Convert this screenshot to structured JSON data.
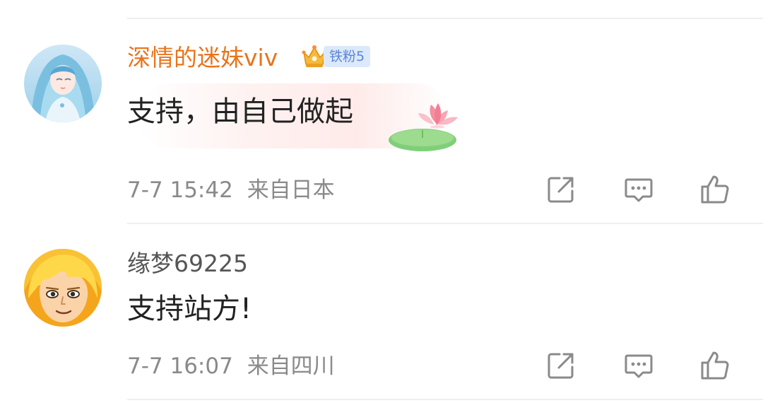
{
  "comments": [
    {
      "username": "深情的迷妹viv",
      "fan_badge": "铁粉5",
      "text": "支持，由自己做起",
      "time": "7-7 15:42",
      "location": "来自日本"
    },
    {
      "username": "缘梦69225",
      "text": "支持站方!",
      "time": "7-7 16:07",
      "location": "来自四川"
    }
  ],
  "colors": {
    "vip_name": "#e8741b",
    "normal_name": "#555555",
    "body_text": "#222222",
    "meta_text": "#8a8a8a",
    "icon": "#8a8a8a",
    "fan_badge_bg": "#dce9fb",
    "fan_badge_text": "#5a86d6"
  },
  "icons": {
    "share": "share-icon",
    "comment": "comment-icon",
    "like": "like-icon",
    "crown": "crown-icon",
    "lotus": "lotus-sticker"
  }
}
